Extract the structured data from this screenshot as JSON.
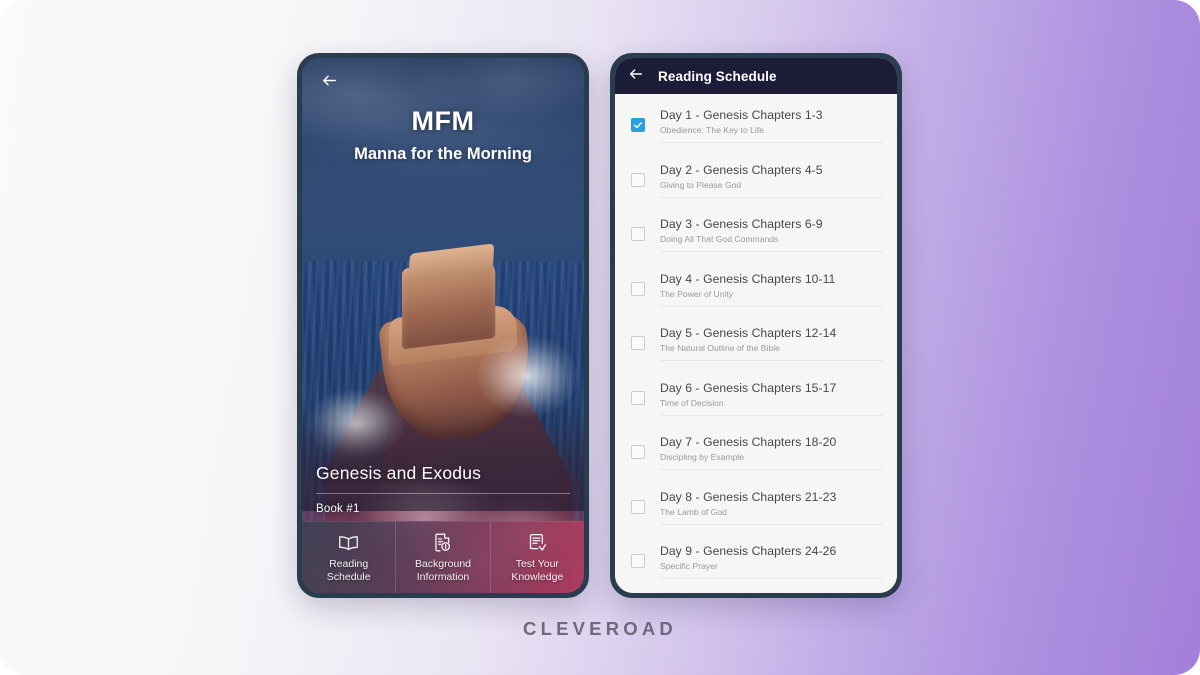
{
  "branding": {
    "wordmark": "CLEVEROAD"
  },
  "colors": {
    "background_left": "#fbfbfc",
    "background_right": "#a47fdc",
    "phone_frame": "#2a3d4e",
    "appbar": "#1c1c38",
    "checkbox_checked": "#2a9fe0",
    "list_background": "#f7f7f5",
    "row_title": "#484848",
    "row_subtitle": "#9b9b9b",
    "wordmark": "#6e6a7c"
  },
  "left_screen": {
    "back_icon": "arrow-left-icon",
    "brand_title": "MFM",
    "brand_subtitle": "Manna for the Morning",
    "book_title": "Genesis and Exodus",
    "book_number": "Book #1",
    "tabs": [
      {
        "icon": "open-book-icon",
        "label": "Reading\nSchedule"
      },
      {
        "icon": "document-info-icon",
        "label": "Background\nInformation"
      },
      {
        "icon": "checklist-check-icon",
        "label": "Test Your\nKnowledge"
      }
    ]
  },
  "right_screen": {
    "back_icon": "arrow-left-icon",
    "title": "Reading Schedule",
    "rows": [
      {
        "title": "Day 1 - Genesis Chapters 1-3",
        "subtitle": "Obedience: The Key to Life",
        "checked": true
      },
      {
        "title": "Day 2 - Genesis Chapters 4-5",
        "subtitle": "Giving to Please God",
        "checked": false
      },
      {
        "title": "Day 3 - Genesis Chapters 6-9",
        "subtitle": "Doing All That God Commands",
        "checked": false
      },
      {
        "title": "Day 4 - Genesis Chapters 10-11",
        "subtitle": "The Power of Unity",
        "checked": false
      },
      {
        "title": "Day 5 - Genesis Chapters 12-14",
        "subtitle": "The Natural Outline of the Bible",
        "checked": false
      },
      {
        "title": "Day 6 - Genesis Chapters 15-17",
        "subtitle": "Time of Decision",
        "checked": false
      },
      {
        "title": "Day 7 - Genesis Chapters 18-20",
        "subtitle": "Discipling by Example",
        "checked": false
      },
      {
        "title": "Day 8 - Genesis Chapters 21-23",
        "subtitle": "The Lamb of God",
        "checked": false
      },
      {
        "title": "Day 9 - Genesis Chapters 24-26",
        "subtitle": "Specific Prayer",
        "checked": false
      }
    ]
  }
}
